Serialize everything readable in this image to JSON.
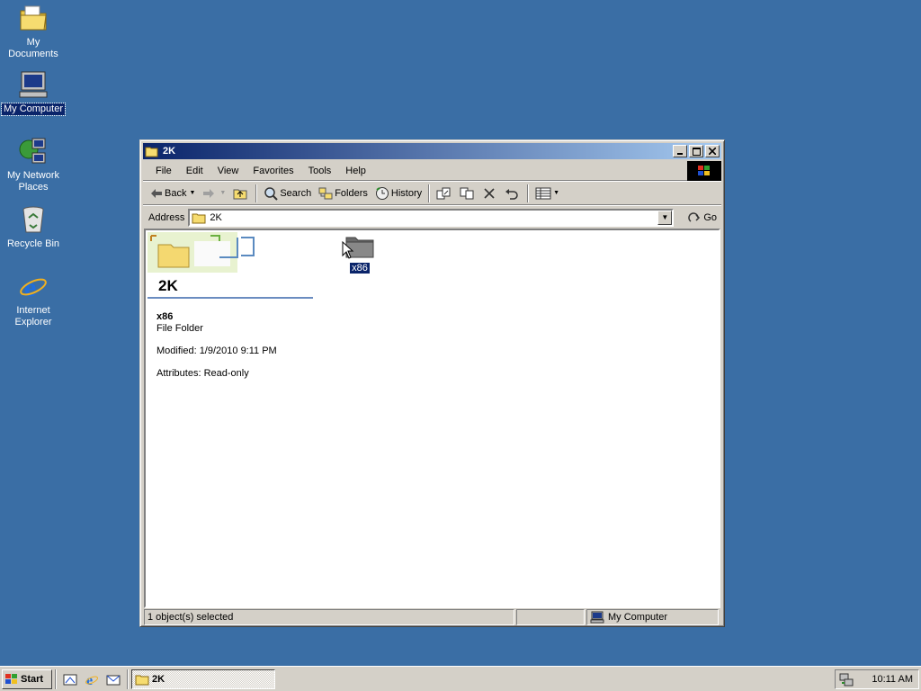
{
  "desktop": {
    "icons": [
      {
        "label": "My Documents"
      },
      {
        "label": "My Computer"
      },
      {
        "label": "My Network Places"
      },
      {
        "label": "Recycle Bin"
      },
      {
        "label": "Internet Explorer"
      }
    ]
  },
  "window": {
    "title": "2K",
    "menu": [
      "File",
      "Edit",
      "View",
      "Favorites",
      "Tools",
      "Help"
    ],
    "toolbar": {
      "back": "Back",
      "search": "Search",
      "folders": "Folders",
      "history": "History"
    },
    "address": {
      "label": "Address",
      "value": "2K",
      "go": "Go"
    },
    "webview": {
      "folder_title": "2K",
      "selected_name": "x86",
      "selected_type": "File Folder",
      "modified": "Modified: 1/9/2010 9:11 PM",
      "attributes": "Attributes: Read-only"
    },
    "files": [
      {
        "name": "x86",
        "selected": true
      }
    ],
    "status": {
      "selection": "1 object(s) selected",
      "zone": "My Computer"
    }
  },
  "taskbar": {
    "start": "Start",
    "task": "2K",
    "clock": "10:11 AM"
  },
  "colors": {
    "desktop": "#3a6ea5",
    "title_active": "#0a246a",
    "face": "#d4d0c8"
  }
}
